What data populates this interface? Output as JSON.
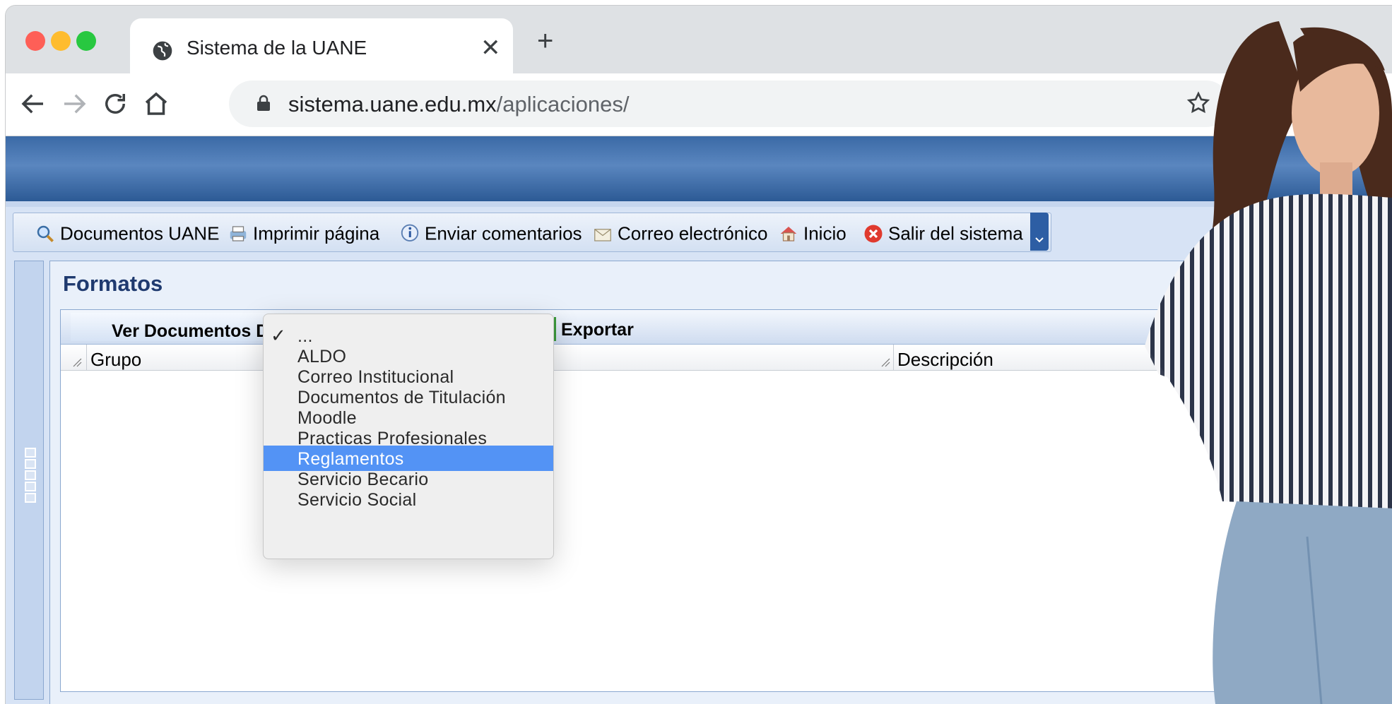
{
  "browser": {
    "tab_title": "Sistema de la UANE",
    "new_tab_symbol": "+",
    "close_symbol": "✕",
    "url_host": "sistema.uane.edu.mx",
    "url_path": "/aplicaciones/",
    "traffic_lights": [
      "#fe5f57",
      "#febc2e",
      "#28c840"
    ]
  },
  "actions": [
    {
      "label": "Documentos UANE",
      "icon": "search-icon"
    },
    {
      "label": "Imprimir página",
      "icon": "printer-icon"
    },
    {
      "label": "Enviar comentarios",
      "icon": "info-icon"
    },
    {
      "label": "Correo electrónico",
      "icon": "mail-icon"
    },
    {
      "label": "Inicio",
      "icon": "home-icon"
    },
    {
      "label": "Salir del sistema",
      "icon": "exit-icon"
    }
  ],
  "panel": {
    "title": "Formatos",
    "ver_documentos_label": "Ver Documentos D",
    "export_label": "Exportar",
    "columns": [
      "Grupo",
      "Descripción"
    ]
  },
  "dropdown": {
    "selected_check": "✓",
    "options": [
      "...",
      "ALDO",
      "Correo Institucional",
      "Documentos de Titulación",
      "Moodle",
      "Practicas Profesionales",
      "Reglamentos",
      "Servicio Becario",
      "Servicio Social"
    ],
    "checked_option": "...",
    "highlighted_option": "Reglamentos"
  },
  "colors": {
    "banner": "#3b6aa6",
    "highlight": "#5393f5",
    "panel_title": "#1f3a6f"
  }
}
